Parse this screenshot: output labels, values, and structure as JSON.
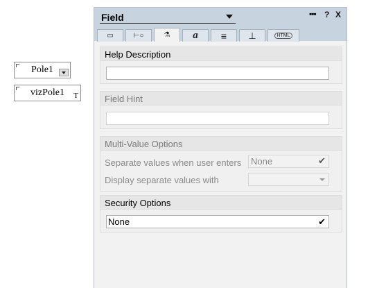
{
  "canvas": {
    "fields": [
      {
        "label": "Pole1"
      },
      {
        "label": "vizPole1",
        "type_mark": "T"
      }
    ]
  },
  "panel": {
    "title": "Field",
    "icons": {
      "dots": "▪▪▪",
      "help": "?",
      "close": "X"
    },
    "tabs": [
      {
        "icon": "field-info-icon",
        "glyph": "▭"
      },
      {
        "icon": "field-control-icon",
        "glyph": "⊢○"
      },
      {
        "icon": "advanced-icon",
        "glyph": "⚗"
      },
      {
        "icon": "font-icon",
        "glyph": "a"
      },
      {
        "icon": "paragraph-icon",
        "glyph": "≡"
      },
      {
        "icon": "hide-when-icon",
        "glyph": "⊥"
      },
      {
        "icon": "html-icon",
        "glyph": "HTML"
      }
    ],
    "help_description": {
      "heading": "Help Description",
      "value": ""
    },
    "field_hint": {
      "heading": "Field Hint",
      "value": ""
    },
    "multi_value": {
      "heading": "Multi-Value Options",
      "separate_label": "Separate values when user enters",
      "separate_value": "None",
      "display_label": "Display separate values with",
      "display_value": ""
    },
    "security": {
      "heading": "Security Options",
      "value": "None"
    }
  }
}
